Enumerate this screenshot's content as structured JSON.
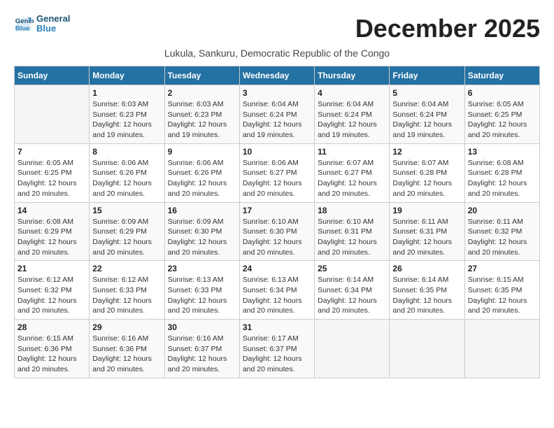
{
  "header": {
    "logo_line1": "General",
    "logo_line2": "Blue",
    "month_title": "December 2025",
    "subtitle": "Lukula, Sankuru, Democratic Republic of the Congo"
  },
  "days_of_week": [
    "Sunday",
    "Monday",
    "Tuesday",
    "Wednesday",
    "Thursday",
    "Friday",
    "Saturday"
  ],
  "weeks": [
    [
      {
        "day": "",
        "info": ""
      },
      {
        "day": "1",
        "info": "Sunrise: 6:03 AM\nSunset: 6:23 PM\nDaylight: 12 hours\nand 19 minutes."
      },
      {
        "day": "2",
        "info": "Sunrise: 6:03 AM\nSunset: 6:23 PM\nDaylight: 12 hours\nand 19 minutes."
      },
      {
        "day": "3",
        "info": "Sunrise: 6:04 AM\nSunset: 6:24 PM\nDaylight: 12 hours\nand 19 minutes."
      },
      {
        "day": "4",
        "info": "Sunrise: 6:04 AM\nSunset: 6:24 PM\nDaylight: 12 hours\nand 19 minutes."
      },
      {
        "day": "5",
        "info": "Sunrise: 6:04 AM\nSunset: 6:24 PM\nDaylight: 12 hours\nand 19 minutes."
      },
      {
        "day": "6",
        "info": "Sunrise: 6:05 AM\nSunset: 6:25 PM\nDaylight: 12 hours\nand 20 minutes."
      }
    ],
    [
      {
        "day": "7",
        "info": "Sunrise: 6:05 AM\nSunset: 6:25 PM\nDaylight: 12 hours\nand 20 minutes."
      },
      {
        "day": "8",
        "info": "Sunrise: 6:06 AM\nSunset: 6:26 PM\nDaylight: 12 hours\nand 20 minutes."
      },
      {
        "day": "9",
        "info": "Sunrise: 6:06 AM\nSunset: 6:26 PM\nDaylight: 12 hours\nand 20 minutes."
      },
      {
        "day": "10",
        "info": "Sunrise: 6:06 AM\nSunset: 6:27 PM\nDaylight: 12 hours\nand 20 minutes."
      },
      {
        "day": "11",
        "info": "Sunrise: 6:07 AM\nSunset: 6:27 PM\nDaylight: 12 hours\nand 20 minutes."
      },
      {
        "day": "12",
        "info": "Sunrise: 6:07 AM\nSunset: 6:28 PM\nDaylight: 12 hours\nand 20 minutes."
      },
      {
        "day": "13",
        "info": "Sunrise: 6:08 AM\nSunset: 6:28 PM\nDaylight: 12 hours\nand 20 minutes."
      }
    ],
    [
      {
        "day": "14",
        "info": "Sunrise: 6:08 AM\nSunset: 6:29 PM\nDaylight: 12 hours\nand 20 minutes."
      },
      {
        "day": "15",
        "info": "Sunrise: 6:09 AM\nSunset: 6:29 PM\nDaylight: 12 hours\nand 20 minutes."
      },
      {
        "day": "16",
        "info": "Sunrise: 6:09 AM\nSunset: 6:30 PM\nDaylight: 12 hours\nand 20 minutes."
      },
      {
        "day": "17",
        "info": "Sunrise: 6:10 AM\nSunset: 6:30 PM\nDaylight: 12 hours\nand 20 minutes."
      },
      {
        "day": "18",
        "info": "Sunrise: 6:10 AM\nSunset: 6:31 PM\nDaylight: 12 hours\nand 20 minutes."
      },
      {
        "day": "19",
        "info": "Sunrise: 6:11 AM\nSunset: 6:31 PM\nDaylight: 12 hours\nand 20 minutes."
      },
      {
        "day": "20",
        "info": "Sunrise: 6:11 AM\nSunset: 6:32 PM\nDaylight: 12 hours\nand 20 minutes."
      }
    ],
    [
      {
        "day": "21",
        "info": "Sunrise: 6:12 AM\nSunset: 6:32 PM\nDaylight: 12 hours\nand 20 minutes."
      },
      {
        "day": "22",
        "info": "Sunrise: 6:12 AM\nSunset: 6:33 PM\nDaylight: 12 hours\nand 20 minutes."
      },
      {
        "day": "23",
        "info": "Sunrise: 6:13 AM\nSunset: 6:33 PM\nDaylight: 12 hours\nand 20 minutes."
      },
      {
        "day": "24",
        "info": "Sunrise: 6:13 AM\nSunset: 6:34 PM\nDaylight: 12 hours\nand 20 minutes."
      },
      {
        "day": "25",
        "info": "Sunrise: 6:14 AM\nSunset: 6:34 PM\nDaylight: 12 hours\nand 20 minutes."
      },
      {
        "day": "26",
        "info": "Sunrise: 6:14 AM\nSunset: 6:35 PM\nDaylight: 12 hours\nand 20 minutes."
      },
      {
        "day": "27",
        "info": "Sunrise: 6:15 AM\nSunset: 6:35 PM\nDaylight: 12 hours\nand 20 minutes."
      }
    ],
    [
      {
        "day": "28",
        "info": "Sunrise: 6:15 AM\nSunset: 6:36 PM\nDaylight: 12 hours\nand 20 minutes."
      },
      {
        "day": "29",
        "info": "Sunrise: 6:16 AM\nSunset: 6:36 PM\nDaylight: 12 hours\nand 20 minutes."
      },
      {
        "day": "30",
        "info": "Sunrise: 6:16 AM\nSunset: 6:37 PM\nDaylight: 12 hours\nand 20 minutes."
      },
      {
        "day": "31",
        "info": "Sunrise: 6:17 AM\nSunset: 6:37 PM\nDaylight: 12 hours\nand 20 minutes."
      },
      {
        "day": "",
        "info": ""
      },
      {
        "day": "",
        "info": ""
      },
      {
        "day": "",
        "info": ""
      }
    ]
  ]
}
